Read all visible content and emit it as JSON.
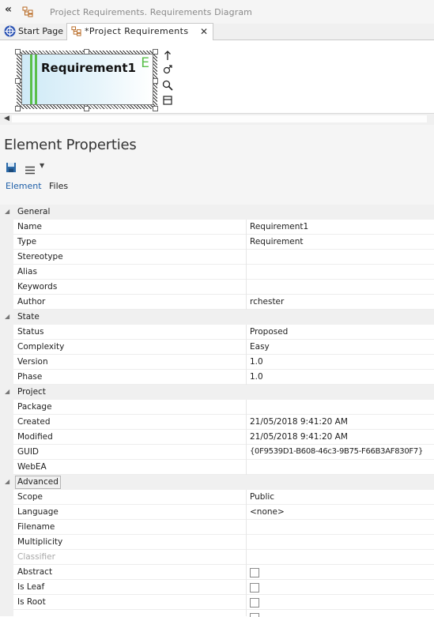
{
  "topbar": {
    "title": "Project Requirements.  Requirements Diagram"
  },
  "tabs": [
    {
      "label": "Start Page",
      "icon": "start-page-icon"
    },
    {
      "label": "*Project Requirements",
      "icon": "diagram-icon",
      "close": "✕",
      "active": true
    }
  ],
  "diagram": {
    "element_name": "Requirement1",
    "element_glyph": "E",
    "toolbar_icons": [
      "arrow-up-icon",
      "link-icon",
      "zoom-icon",
      "panel-icon"
    ]
  },
  "properties": {
    "title": "Element Properties",
    "tabs": [
      "Element",
      "Files"
    ],
    "groups": [
      {
        "label": "General",
        "rows": [
          {
            "name": "Name",
            "value": "Requirement1"
          },
          {
            "name": "Type",
            "value": "Requirement"
          },
          {
            "name": "Stereotype",
            "value": ""
          },
          {
            "name": "Alias",
            "value": ""
          },
          {
            "name": "Keywords",
            "value": ""
          },
          {
            "name": "Author",
            "value": "rchester"
          }
        ]
      },
      {
        "label": "State",
        "rows": [
          {
            "name": "Status",
            "value": "Proposed"
          },
          {
            "name": "Complexity",
            "value": "Easy"
          },
          {
            "name": "Version",
            "value": "1.0"
          },
          {
            "name": "Phase",
            "value": "1.0"
          }
        ]
      },
      {
        "label": "Project",
        "rows": [
          {
            "name": "Package",
            "value": ""
          },
          {
            "name": "Created",
            "value": "21/05/2018 9:41:20 AM"
          },
          {
            "name": "Modified",
            "value": "21/05/2018 9:41:20 AM"
          },
          {
            "name": "GUID",
            "value": "{0F9539D1-B608-46c3-9B75-F66B3AF830F7}"
          },
          {
            "name": "WebEA",
            "value": ""
          }
        ]
      },
      {
        "label": "Advanced",
        "rows": [
          {
            "name": "Scope",
            "value": "Public"
          },
          {
            "name": "Language",
            "value": "<none>"
          },
          {
            "name": "Filename",
            "value": ""
          },
          {
            "name": "Multiplicity",
            "value": ""
          },
          {
            "name": "Classifier",
            "value": ""
          },
          {
            "name": "Abstract",
            "checkbox": false
          },
          {
            "name": "Is Leaf",
            "checkbox": false
          },
          {
            "name": "Is Root",
            "checkbox": false
          }
        ]
      }
    ]
  }
}
